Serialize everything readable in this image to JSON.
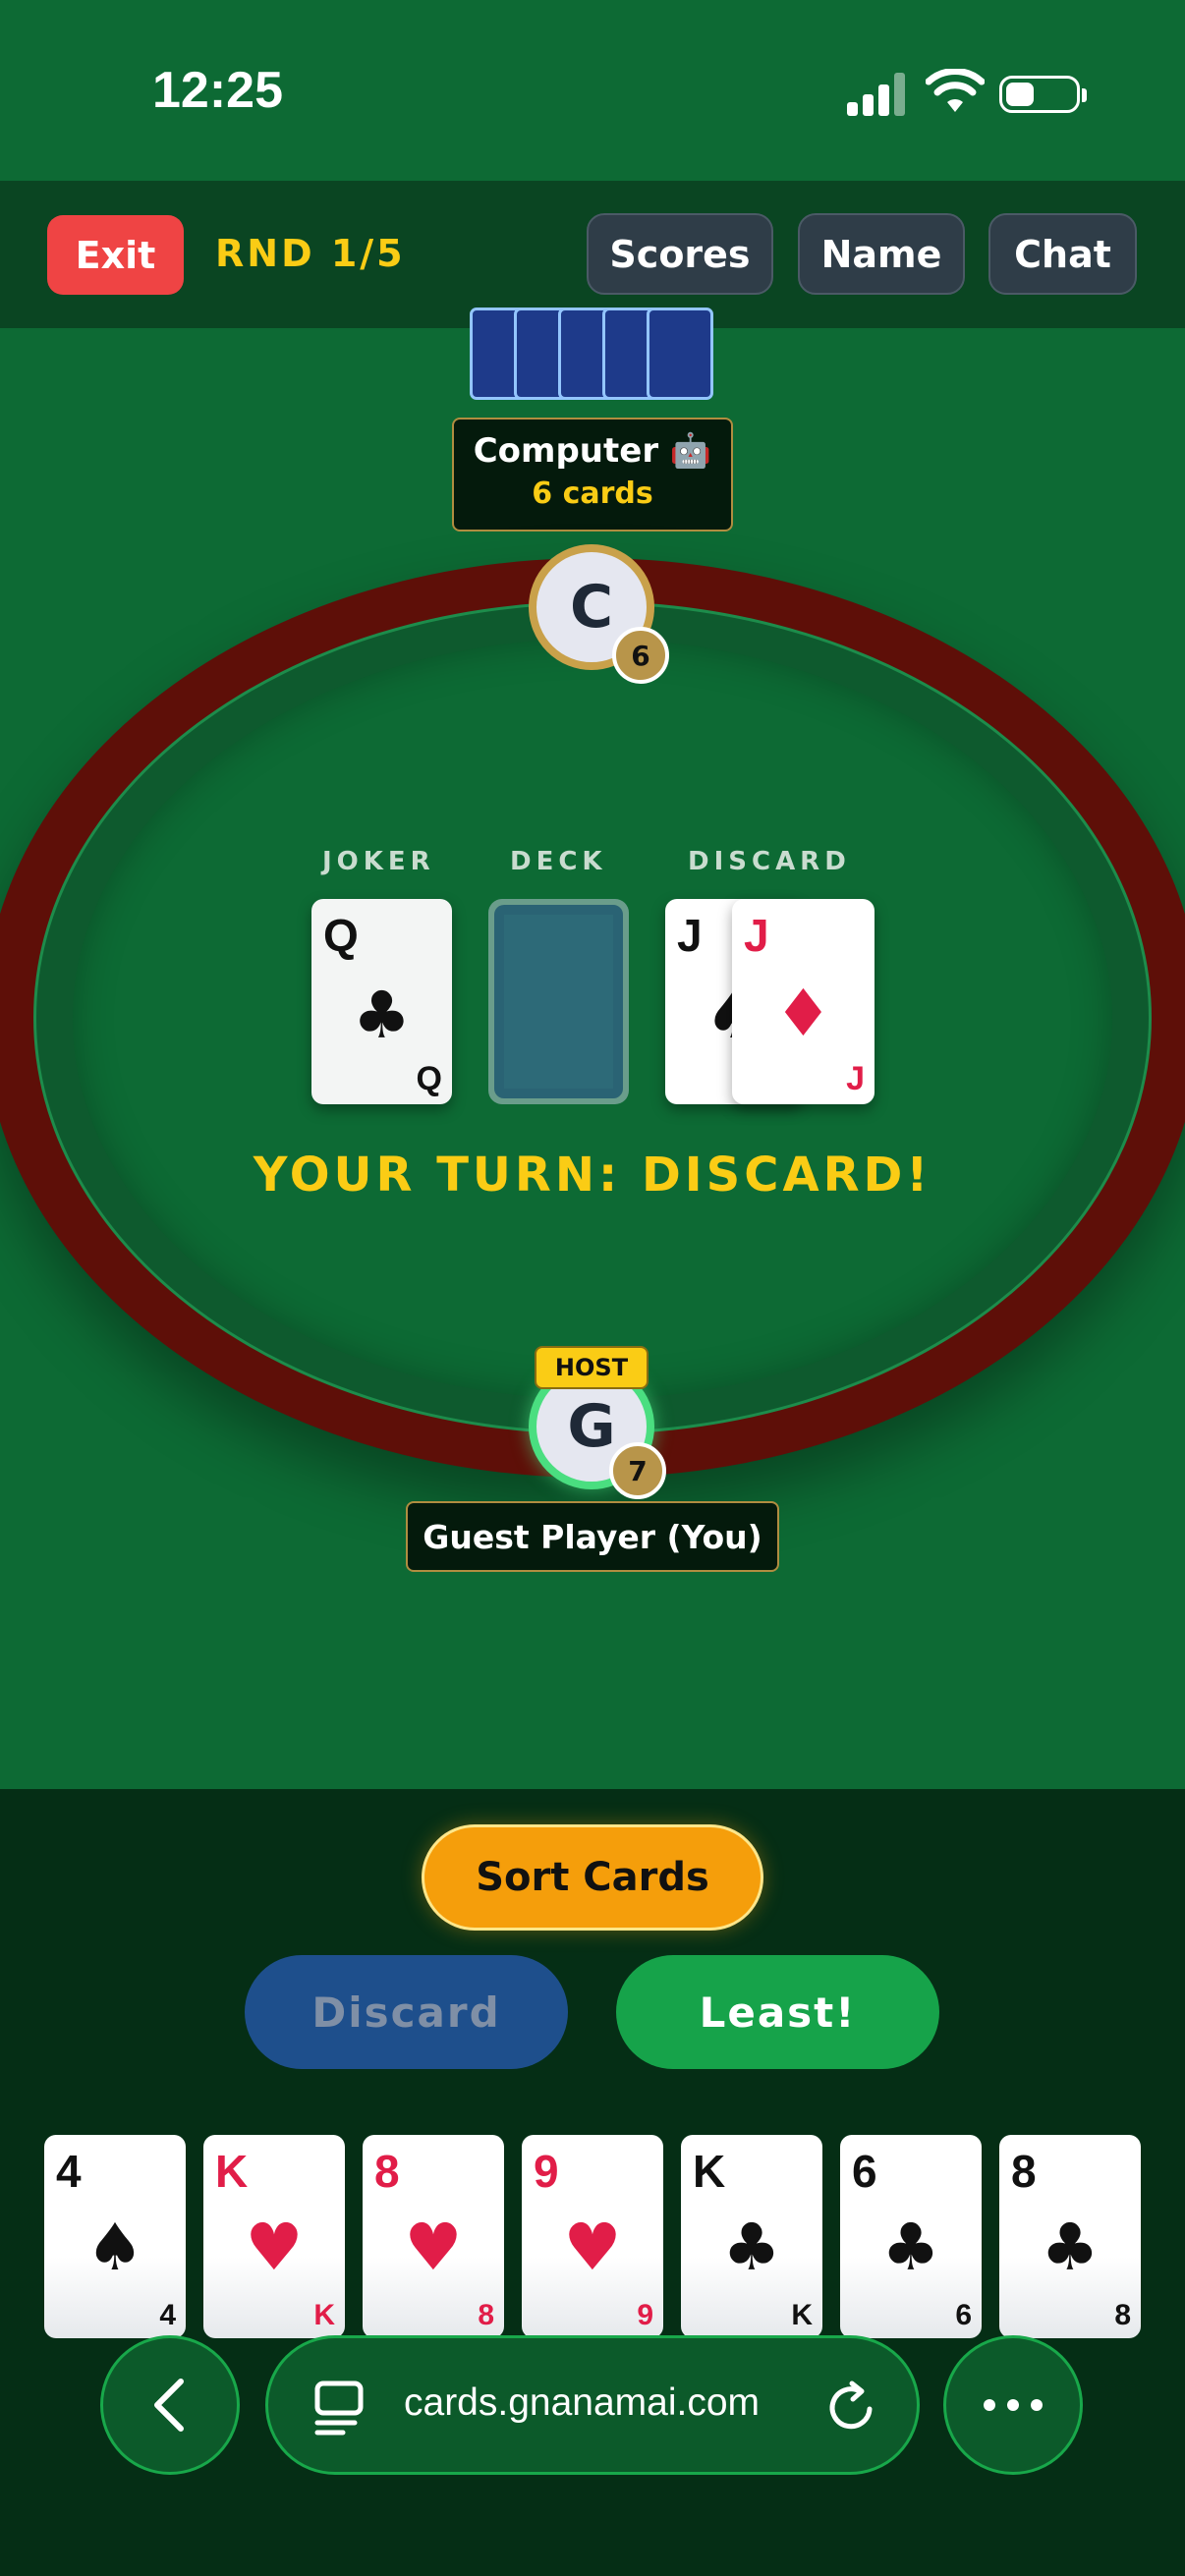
{
  "status_bar": {
    "time": "12:25"
  },
  "header": {
    "exit_label": "Exit",
    "round": "RND 1/5",
    "scores_label": "Scores",
    "name_label": "Name",
    "chat_label": "Chat"
  },
  "opponent": {
    "name": "Computer 🤖",
    "cards": "6 cards",
    "initial": "C",
    "badge": "6",
    "hidden_card_count": 5
  },
  "table": {
    "joker_label": "JOKER",
    "deck_label": "DECK",
    "discard_label": "DISCARD",
    "joker_card": {
      "rank": "Q",
      "suit": "♣"
    },
    "discard_under": {
      "rank": "J",
      "suit": "♠"
    },
    "discard_top": {
      "rank": "J",
      "suit": "♦"
    },
    "turn_message": "YOUR TURN: DISCARD!"
  },
  "player": {
    "host_tag": "HOST",
    "initial": "G",
    "badge": "7",
    "name": "Guest Player (You)"
  },
  "actions": {
    "sort_label": "Sort Cards",
    "discard_label": "Discard",
    "least_label": "Least!"
  },
  "hand": [
    {
      "rank": "4",
      "suit": "♠",
      "color": "black"
    },
    {
      "rank": "K",
      "suit": "♥",
      "color": "red"
    },
    {
      "rank": "8",
      "suit": "♥",
      "color": "red"
    },
    {
      "rank": "9",
      "suit": "♥",
      "color": "red"
    },
    {
      "rank": "K",
      "suit": "♣",
      "color": "black"
    },
    {
      "rank": "6",
      "suit": "♣",
      "color": "black"
    },
    {
      "rank": "8",
      "suit": "♣",
      "color": "black"
    }
  ],
  "browser": {
    "url": "cards.gnanamai.com",
    "back_icon": "chevron-left-icon",
    "reader_icon": "reader-icon",
    "reload_icon": "reload-icon",
    "more_icon": "more-icon"
  },
  "colors": {
    "background": "#0d6a34",
    "table_rim": "#5e0f08",
    "accent_yellow": "#facc15",
    "exit_red": "#ef4444",
    "sort_orange": "#f59e0b",
    "least_green": "#16a34a",
    "discard_blue": "#1e4f8c"
  }
}
